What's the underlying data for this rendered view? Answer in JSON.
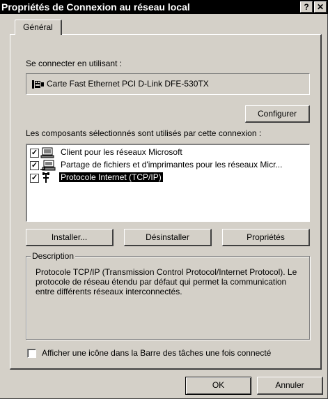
{
  "window": {
    "title": "Propriétés de Connexion au réseau local",
    "help_label": "?",
    "close_label": "✕"
  },
  "tabs": [
    {
      "label": "Général"
    }
  ],
  "connect_using": {
    "label": "Se connecter en utilisant :",
    "adapter": "Carte Fast Ethernet PCI D-Link DFE-530TX"
  },
  "buttons": {
    "configure": "Configurer",
    "install": "Installer...",
    "uninstall": "Désinstaller",
    "properties": "Propriétés",
    "ok": "OK",
    "cancel": "Annuler"
  },
  "components": {
    "label": "Les composants sélectionnés sont utilisés par cette connexion :",
    "items": [
      {
        "label": "Client pour les réseaux Microsoft",
        "checked": true,
        "icon": "network-client-icon"
      },
      {
        "label": "Partage de fichiers et d'imprimantes pour les réseaux Micr...",
        "checked": true,
        "icon": "file-printer-sharing-icon"
      },
      {
        "label": "Protocole Internet (TCP/IP)",
        "checked": true,
        "icon": "protocol-icon",
        "selected": true
      }
    ]
  },
  "description": {
    "legend": "Description",
    "text": "Protocole TCP/IP (Transmission Control Protocol/Internet Protocol). Le protocole de réseau étendu par défaut qui permet la communication entre différents réseaux interconnectés."
  },
  "show_icon": {
    "label": "Afficher une icône dans la Barre des tâches une fois connecté",
    "checked": false
  },
  "colors": {
    "face": "#d4d0c8",
    "titlebar": "#000000",
    "selection": "#000000"
  }
}
